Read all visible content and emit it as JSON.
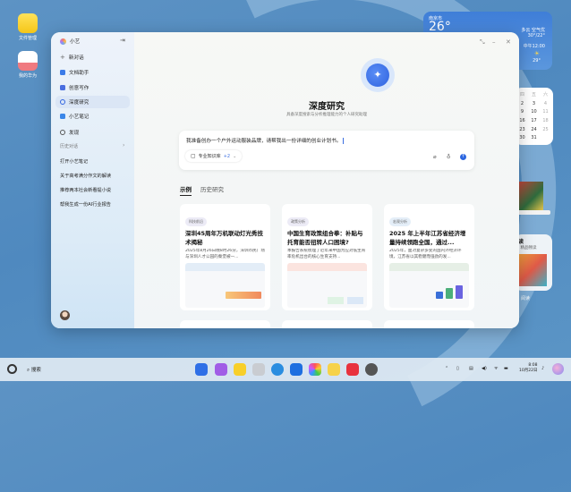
{
  "desktop": {
    "icons": [
      {
        "label": "文件管理",
        "icon": "folder-icon"
      },
      {
        "label": "我的华为",
        "icon": "huawei-icon"
      }
    ]
  },
  "weather": {
    "location": "南京市",
    "temp": "26°",
    "condition": "多云 空气优",
    "range": "30°/22°",
    "hour": "中午12:00",
    "hour_temp": "29°"
  },
  "calendar": {
    "header": [
      "四",
      "五",
      "六"
    ],
    "rows": [
      [
        "2",
        "3",
        "4"
      ],
      [
        "9",
        "10",
        "11"
      ],
      [
        "16",
        "17",
        "18"
      ],
      [
        "23",
        "24",
        "25"
      ],
      [
        "30",
        "31",
        ""
      ]
    ]
  },
  "reading": {
    "title": "读",
    "subtitle": "，精品畅读",
    "label": "阅读"
  },
  "sidebar": {
    "app_name": "小艺",
    "items": [
      {
        "label": "新对话",
        "icon": "plus-icon"
      },
      {
        "label": "文档助手",
        "icon": "document-icon"
      },
      {
        "label": "创意写作",
        "icon": "pen-icon"
      },
      {
        "label": "深度研究",
        "icon": "search-icon",
        "selected": true
      },
      {
        "label": "小艺笔记",
        "icon": "note-icon"
      },
      {
        "label": "发现",
        "icon": "discover-icon"
      }
    ],
    "history_label": "历史对话",
    "history": [
      "打开小艺笔记",
      "关于高考满分作文的解读",
      "推荐两本社会新看提小说",
      "帮我生成一份AI行业报告"
    ]
  },
  "main": {
    "title": "深度研究",
    "subtitle": "具备深度搜索与分析推理能力的个人研究助理",
    "input_value": "我准备创办一个户外运动服装品牌，请帮我出一份详细的创业计划书。",
    "kb_chip": "专业知识库",
    "kb_extra": "+2",
    "tabs": [
      "示例",
      "历史研究"
    ],
    "cards": [
      {
        "tag": "科技前沿",
        "title": "深圳45周年万机联动灯光秀技术揭秘",
        "desc": "2025年8月26日晚8时26分，深圳市民广场与深圳人才公园的秦堡被一..."
      },
      {
        "tag": "政策分析",
        "title": "中国生育政策组合拳：补贴与托育能否扭转人口困境?",
        "desc": "本报告系统梳理了近年来中国为应对低生育率危机出台的核心生育支持..."
      },
      {
        "tag": "宏观分析",
        "title": "2025 年上半年江苏省经济增量持续领跑全国，通过...",
        "desc": "2025年，面对复杂多变的国内外经济环境，江苏省以其稳健而强劲的发..."
      }
    ]
  },
  "taskbar": {
    "search": "搜索",
    "time": "8:08",
    "date": "10月22日"
  },
  "colors": {
    "accent": "#2b66e0",
    "desktop": "#5189bf",
    "selected": "#dbe6f5"
  }
}
